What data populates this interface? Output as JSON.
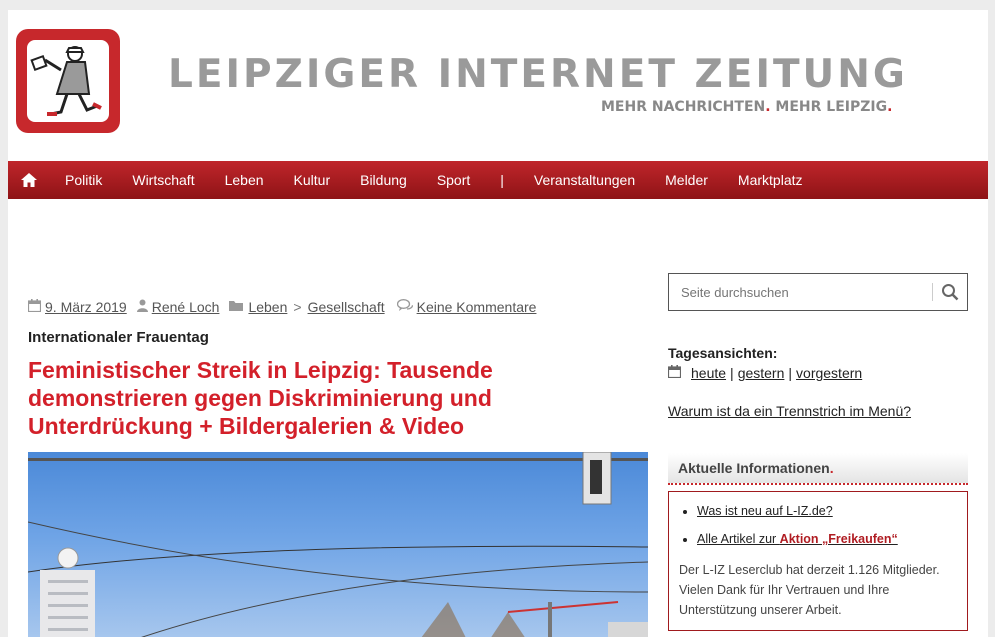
{
  "site": {
    "title": "LEIPZIGER INTERNET ZEITUNG",
    "tagline_part1": "MEHR NACHRICHTEN",
    "tagline_dot1": ".",
    "tagline_part2": " MEHR LEIPZIG",
    "tagline_dot2": "."
  },
  "nav": {
    "items": [
      {
        "label": "Politik"
      },
      {
        "label": "Wirtschaft"
      },
      {
        "label": "Leben"
      },
      {
        "label": "Kultur"
      },
      {
        "label": "Bildung"
      },
      {
        "label": "Sport"
      },
      {
        "label": "|"
      },
      {
        "label": "Veranstaltungen"
      },
      {
        "label": "Melder"
      },
      {
        "label": "Marktplatz"
      }
    ]
  },
  "article": {
    "date": "9. März 2019",
    "author": "René Loch",
    "category": "Leben",
    "category_sep": ">",
    "subcategory": "Gesellschaft",
    "comments": "Keine Kommentare",
    "kicker": "Internationaler Frauentag",
    "headline": "Feministischer Streik in Leipzig: Tausende demonstrieren gegen Diskriminierung und Unterdrückung + Bildergalerien & Video"
  },
  "sidebar": {
    "search_placeholder": "Seite durchsuchen",
    "tages_label": "Tagesansichten:",
    "tages_links": [
      {
        "label": "heute"
      },
      {
        "label": "gestern"
      },
      {
        "label": "vorgestern"
      }
    ],
    "tages_sep": "|",
    "trenn_link": "Warum ist da ein Trennstrich im Menü?",
    "box_title": "Aktuelle Informationen",
    "box_title_dot": ".",
    "box_link1": "Was ist neu auf L-IZ.de?",
    "box_link2_prefix": "Alle Artikel zur ",
    "box_link2_highlight": "Aktion „Freikaufen“",
    "box_text": "Der L-IZ Leserclub hat derzeit 1.126 Mitglieder. Vielen Dank für Ihr Vertrauen und Ihre Unterstützung unserer Arbeit."
  },
  "colors": {
    "brand_red": "#c7282c",
    "headline_red": "#d3202a",
    "nav_top": "#c0262b",
    "nav_bottom": "#8e1316"
  },
  "icons": {
    "logo": "newspaper-carrier-logo",
    "home": "home-icon",
    "date": "calendar-icon",
    "author": "user-icon",
    "category": "folder-icon",
    "comments": "comments-icon",
    "search": "search-icon"
  }
}
